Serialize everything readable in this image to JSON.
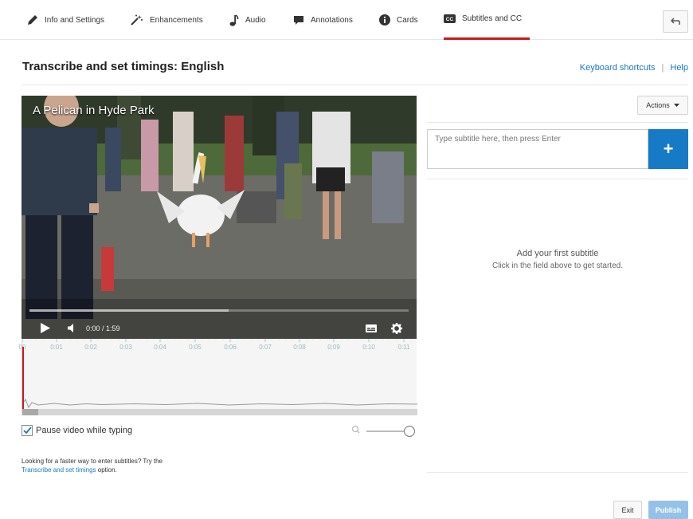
{
  "tabs": [
    {
      "label": "Info and Settings",
      "icon": "pencil-icon"
    },
    {
      "label": "Enhancements",
      "icon": "magic-wand-icon"
    },
    {
      "label": "Audio",
      "icon": "music-note-icon"
    },
    {
      "label": "Annotations",
      "icon": "speech-bubble-icon"
    },
    {
      "label": "Cards",
      "icon": "info-circle-icon"
    },
    {
      "label": "Subtitles and CC",
      "icon": "cc-icon",
      "active": true
    }
  ],
  "header": {
    "title": "Transcribe and set timings: English",
    "keyboard_shortcuts": "Keyboard shortcuts",
    "separator": "|",
    "help": "Help"
  },
  "video": {
    "title": "A Pelican in Hyde Park",
    "time": "0:00 / 1:59"
  },
  "timeline": {
    "ticks": [
      "00",
      "0:01",
      "0:02",
      "0:03",
      "0:04",
      "0:05",
      "0:06",
      "0:07",
      "0:08",
      "0:09",
      "0:10",
      "0:11"
    ]
  },
  "options": {
    "pause_label": "Pause video while typing",
    "pause_checked": true
  },
  "hint": {
    "text": "Looking for a faster way to enter subtitles? Try the",
    "link": "Transcribe and set timings",
    "suffix": " option."
  },
  "panel": {
    "actions_label": "Actions",
    "input_placeholder": "Type subtitle here, then press Enter",
    "add_symbol": "+",
    "empty_title": "Add your first subtitle",
    "empty_subtitle": "Click in the field above to get started."
  },
  "footer": {
    "exit_label": "Exit",
    "publish_label": "Publish"
  },
  "colors": {
    "accent": "#167ac6",
    "active_tab": "#cc181e",
    "publish_disabled": "#95c1e8"
  }
}
